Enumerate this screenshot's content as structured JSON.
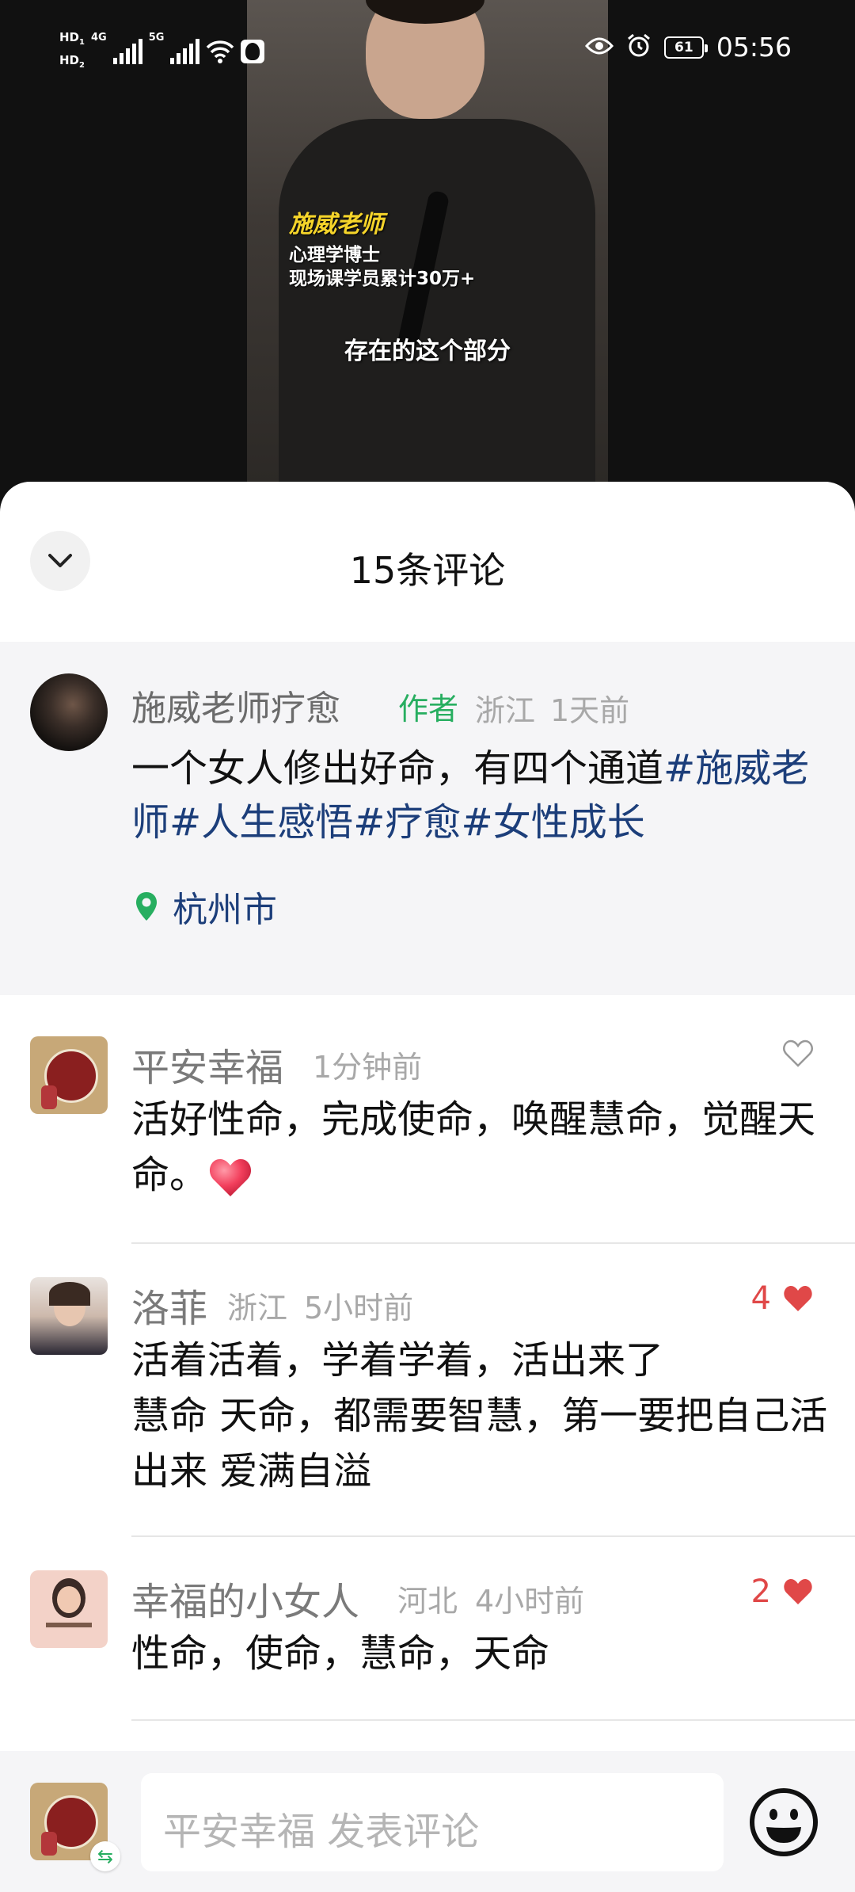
{
  "statusbar": {
    "hd1": "HD",
    "hd1_sub": "1",
    "hd2": "HD",
    "hd2_sub": "2",
    "net1": "4G",
    "net2": "5G",
    "battery": "61",
    "time": "05:56"
  },
  "video": {
    "caption_name": "施威老师",
    "caption_line1": "心理学博士",
    "caption_line2": "现场课学员累计30万+",
    "subtitle": "存在的这个部分"
  },
  "sheet": {
    "title": "15条评论"
  },
  "author_post": {
    "name": "施威老师疗愈",
    "tag": "作者",
    "region": "浙江",
    "time": "1天前",
    "text": "一个女人修出好命，有四个通道",
    "hashtags": [
      "#施威老师",
      "#人生感悟",
      "#疗愈",
      "#女性成长"
    ],
    "location": "杭州市"
  },
  "comments": [
    {
      "name": "平安幸福",
      "region": "",
      "time": "1分钟前",
      "text": "活好性命，完成使命，唤醒慧命，觉醒天命。",
      "likes": "",
      "liked": false
    },
    {
      "name": "洛菲",
      "region": "浙江",
      "time": "5小时前",
      "text_lines": [
        "活着活着，学着学着，活出来了",
        "慧命 天命，都需要智慧，第一要把自己活出来 爱满自溢"
      ],
      "likes": "4",
      "liked": true
    },
    {
      "name": "幸福的小女人",
      "region": "河北",
      "time": "4小时前",
      "text": "性命，使命，慧命，天命",
      "likes": "2",
      "liked": true
    }
  ],
  "input_bar": {
    "placeholder": "平安幸福 发表评论",
    "switch_icon": "⇆"
  },
  "colors": {
    "accent_green": "#27ae60",
    "hashtag_blue": "#1c3e7a",
    "like_red": "#e04848"
  },
  "icons": [
    "chevron-down-icon",
    "location-pin-icon",
    "heart-outline-icon",
    "heart-filled-icon",
    "emoji-icon",
    "eye-icon",
    "alarm-icon",
    "wifi-icon",
    "qq-icon"
  ]
}
